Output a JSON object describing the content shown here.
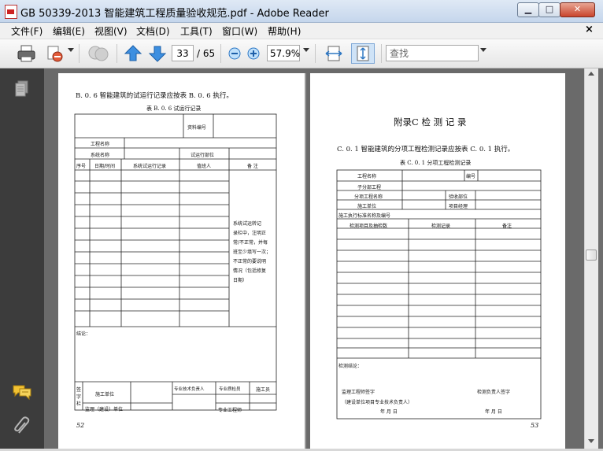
{
  "window": {
    "title": "GB 50339-2013 智能建筑工程质量验收规范.pdf - Adobe Reader",
    "btn_min": "▭",
    "btn_max": "□",
    "btn_close": "✕"
  },
  "menu": {
    "items": [
      "文件(F)",
      "编辑(E)",
      "视图(V)",
      "文档(D)",
      "工具(T)",
      "窗口(W)",
      "帮助(H)"
    ],
    "close": "×"
  },
  "toolbar": {
    "page_current": "33",
    "page_total": "/ 65",
    "zoom": "57.9%",
    "search_placeholder": "查找"
  },
  "left_page": {
    "heading": "B. 0. 6   智能建筑的试运行记录应按表 B. 0. 6 执行。",
    "table_title": "表 B. 0. 6    试运行记录",
    "doc_no": "资料编号",
    "project_name": "工程名称",
    "system_name": "系统名称",
    "trial_part": "试运行部位",
    "col_no": "序号",
    "col_date": "日期/时间",
    "col_record": "系统试运行记录",
    "col_person": "值班人",
    "col_note": "备  注",
    "note_text": [
      "系统试运转记",
      "录栏中，注明正",
      "常/不正常，并每",
      "班至少填写一次；",
      "不正常的要说明",
      "情况（包括修复",
      "日期）"
    ],
    "conclusion": "结论：",
    "sign_vertical": "签字栏",
    "construction_unit": "施工单位",
    "supervision_unit": "监理（建设）单位",
    "tech_lead": "专业技术负责人",
    "qa_inspector": "专业质检员",
    "worker": "施工员",
    "specialty_engineer": "专业工程师",
    "page_number": "52"
  },
  "right_page": {
    "appendix_title": "附录C   检 测 记 录",
    "heading": "C. 0. 1   智能建筑的分项工程检测记录应按表 C. 0. 1 执行。",
    "table_title": "表 C. 0. 1    分项工程检测记录",
    "project_name": "工程名称",
    "number": "编号",
    "sub_project": "子分部工程",
    "item_project": "分项工程名称",
    "inspection_part": "验收部位",
    "construction_unit": "施工单位",
    "project_manager": "项目经理",
    "standard": "施工执行标准名称及编号",
    "col_item": "检测项目及抽检数",
    "col_record": "检测记录",
    "col_note": "备注",
    "conclusion": "检测结论：",
    "supervisor_sign": "监理工程师签字",
    "supervisor_sign_2": "（建设单位项目专业技术负责人）",
    "inspector_sign": "检测负责人签字",
    "date_left": "年    月    日",
    "date_right": "年    月    日",
    "page_number": "53"
  }
}
